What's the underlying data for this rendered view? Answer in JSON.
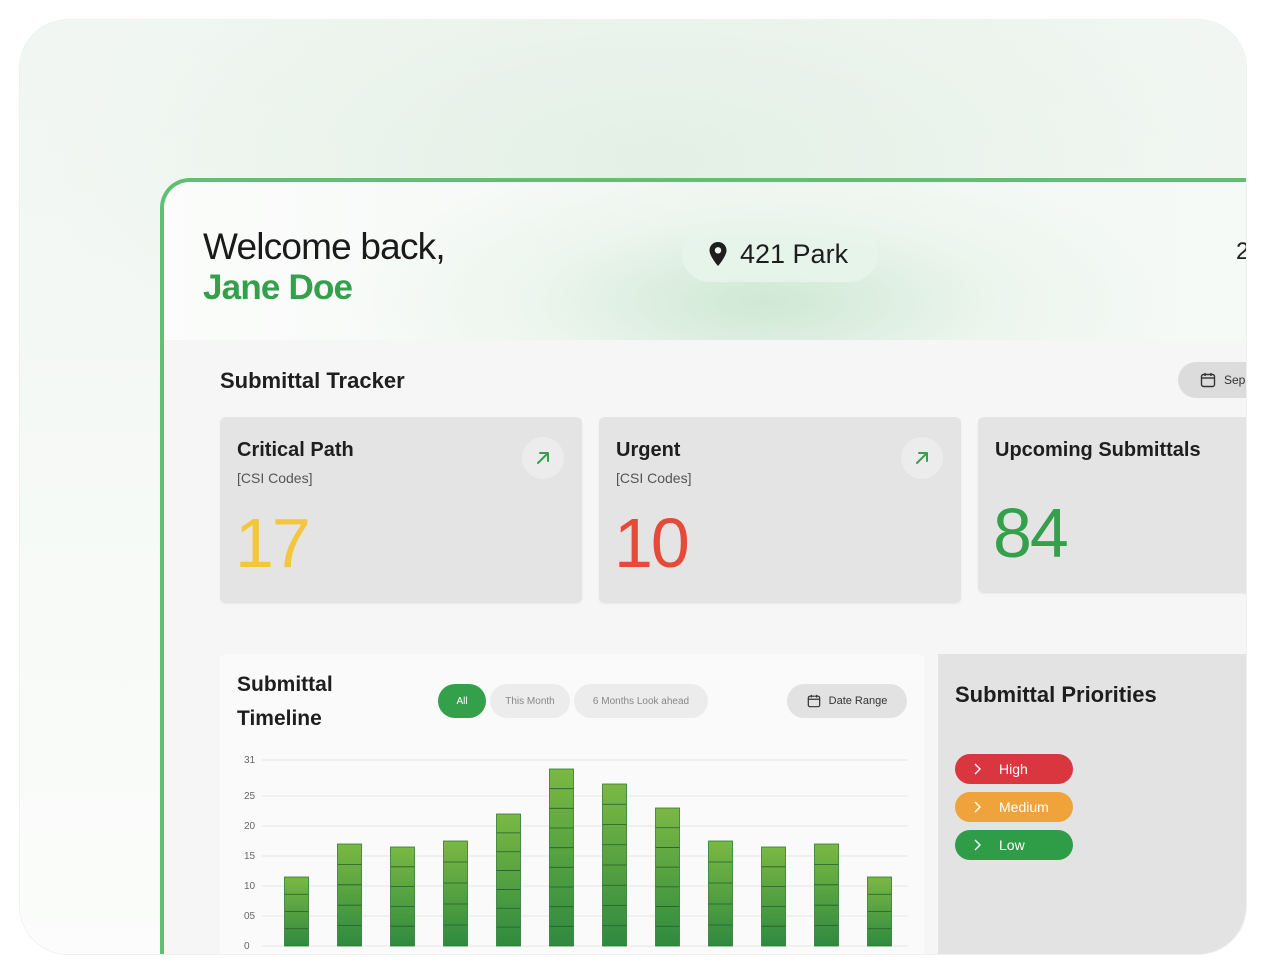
{
  "header": {
    "welcome": "Welcome back,",
    "user_name": "Jane Doe",
    "location": "421 Park",
    "corner_text": "2"
  },
  "tracker": {
    "title": "Submittal Tracker",
    "date_chip": "Sep",
    "cards": [
      {
        "title": "Critical Path",
        "subtitle": "[CSI Codes]",
        "value": "17",
        "color": "#f4c63d"
      },
      {
        "title": "Urgent",
        "subtitle": "[CSI Codes]",
        "value": "10",
        "color": "#e64a3b"
      },
      {
        "title": "Upcoming Submittals",
        "value": "84",
        "color": "#35a04b"
      }
    ]
  },
  "timeline": {
    "title": "Submittal Timeline",
    "filters": {
      "all": "All",
      "this_month": "This Month",
      "six_months": "6 Months Look ahead"
    },
    "date_range": "Date Range"
  },
  "priorities": {
    "title": "Submittal Priorities",
    "levels": [
      {
        "label": "High",
        "color": "#d9363f"
      },
      {
        "label": "Medium",
        "color": "#f0a33a"
      },
      {
        "label": "Low",
        "color": "#2f9d48"
      }
    ]
  },
  "chart_data": {
    "type": "bar",
    "stacked": true,
    "y_tick_labels": [
      "0",
      "05",
      "10",
      "15",
      "20",
      "25",
      "31"
    ],
    "ylim": [
      0,
      31
    ],
    "grid": true,
    "values": [
      11.5,
      17,
      16.5,
      17.5,
      22,
      29.5,
      27,
      23,
      17.5,
      16.5,
      17,
      11.5
    ]
  }
}
